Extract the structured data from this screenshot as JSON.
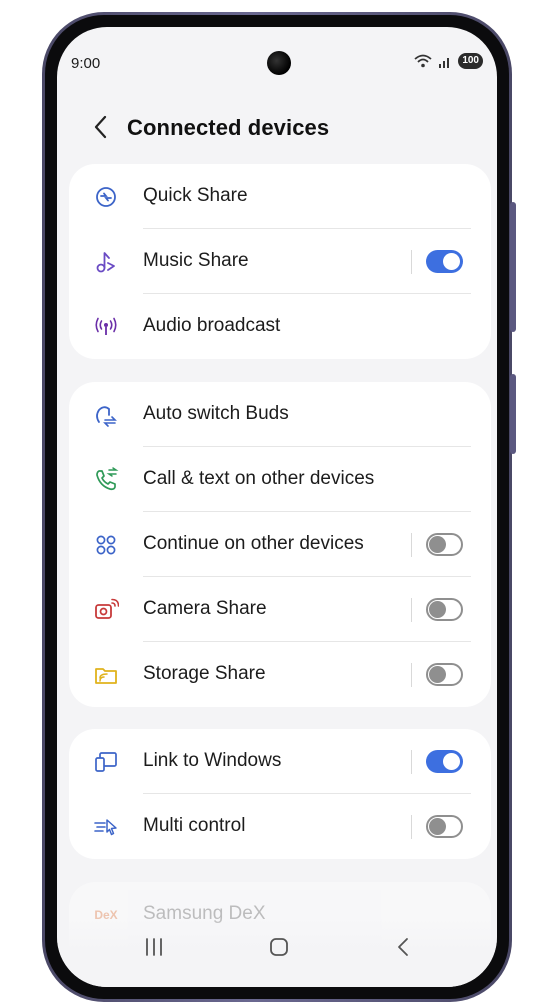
{
  "status_bar": {
    "time": "9:00",
    "battery": "100"
  },
  "header": {
    "title": "Connected devices"
  },
  "card1": {
    "items": [
      {
        "label": "Quick Share"
      },
      {
        "label": "Music Share",
        "toggle": "on"
      },
      {
        "label": "Audio broadcast"
      }
    ]
  },
  "card2": {
    "items": [
      {
        "label": "Auto switch Buds"
      },
      {
        "label": "Call & text on other devices"
      },
      {
        "label": "Continue on other devices",
        "toggle": "off"
      },
      {
        "label": "Camera Share",
        "toggle": "off"
      },
      {
        "label": "Storage Share",
        "toggle": "off"
      }
    ]
  },
  "card3": {
    "items": [
      {
        "label": "Link to Windows",
        "toggle": "on"
      },
      {
        "label": "Multi control",
        "toggle": "off"
      }
    ]
  },
  "card4": {
    "items": [
      {
        "label": "Samsung DeX",
        "icon_text": "DeX"
      }
    ]
  },
  "colors": {
    "accent": "#3d6fe0",
    "toggle_off": "#8f8f8f",
    "screen_bg": "#f4f4f6"
  }
}
